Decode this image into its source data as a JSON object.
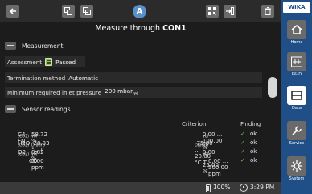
{
  "header": {
    "title_prefix": "Measure through",
    "title_target": "CON1",
    "badge": "A"
  },
  "sections": {
    "measurement": "Measurement",
    "sensor": "Sensor readings"
  },
  "measurement": {
    "assessment_label": "Assessment",
    "assessment_value": "Passed",
    "termination_label": "Termination method",
    "termination_value": "Automatic",
    "pressure_label": "Minimum required inlet pressure",
    "pressure_value": "200 mbar",
    "pressure_unit_sub": "rel"
  },
  "sensor_table": {
    "headers": {
      "criterion": "Criterion",
      "finding": "Finding"
    },
    "rows": [
      {
        "name": "C4-FN",
        "name_sub": "(CO2)",
        "value": "58.72 %",
        "value_sub": "vol",
        "crit": "0.00 ... 100.00 %",
        "crit_sub": "vol",
        "finding": "ok"
      },
      {
        "name": "H2O",
        "name_sub": "(CO2)",
        "value": "-28.33 °C T",
        "value_sub": "D(atm)",
        "crit": "-75.00 ... 20.00 °C T",
        "crit_sub": "D(atm)",
        "finding": "ok"
      },
      {
        "name": "O2",
        "name_sub": "(CO2)",
        "value": "0.82 %",
        "value_sub": "vol",
        "crit": "0.00 ... 25.00 %",
        "crit_sub": "vol",
        "finding": "ok"
      },
      {
        "name": "CO",
        "name_sub": "",
        "value": "0.00 ppm",
        "value_sub": "",
        "crit": "0.00 ... 500.00 ppm",
        "crit_sub": "",
        "finding": "ok"
      }
    ]
  },
  "status_bar": {
    "battery": "100%",
    "time": "3:29 PM"
  },
  "sidebar": {
    "logo": "WIKA",
    "items": [
      {
        "label": "Home",
        "icon": "home-icon"
      },
      {
        "label": "P&ID",
        "icon": "pid-icon"
      },
      {
        "label": "Data",
        "icon": "data-icon"
      },
      {
        "label": "Service",
        "icon": "wrench-icon"
      },
      {
        "label": "System",
        "icon": "gear-icon"
      }
    ]
  },
  "colors": {
    "sidebar": "#1f4f86",
    "accent": "#5a8fc7",
    "ok": "#6fc253"
  }
}
